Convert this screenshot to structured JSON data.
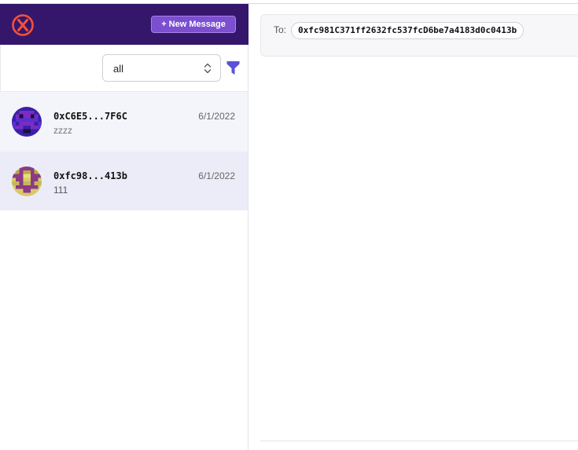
{
  "sidebar": {
    "header": {
      "new_message_label": "+ New Message",
      "brand_color": "#34176b",
      "logo_color": "#fc4f37"
    },
    "filter": {
      "selected": "all",
      "accent_color": "#5b52d8"
    },
    "conversations": [
      {
        "address": "0xC6E5...7F6C",
        "preview": "zzzz",
        "date": "6/1/2022",
        "avatar": "pixel-avatar-blue"
      },
      {
        "address": "0xfc98...413b",
        "preview": "111",
        "date": "6/1/2022",
        "avatar": "pixel-avatar-yellow"
      }
    ]
  },
  "main": {
    "to_label": "To:",
    "recipient": "0xfc981C371ff2632fc537fcD6be7a4183d0c0413b"
  }
}
